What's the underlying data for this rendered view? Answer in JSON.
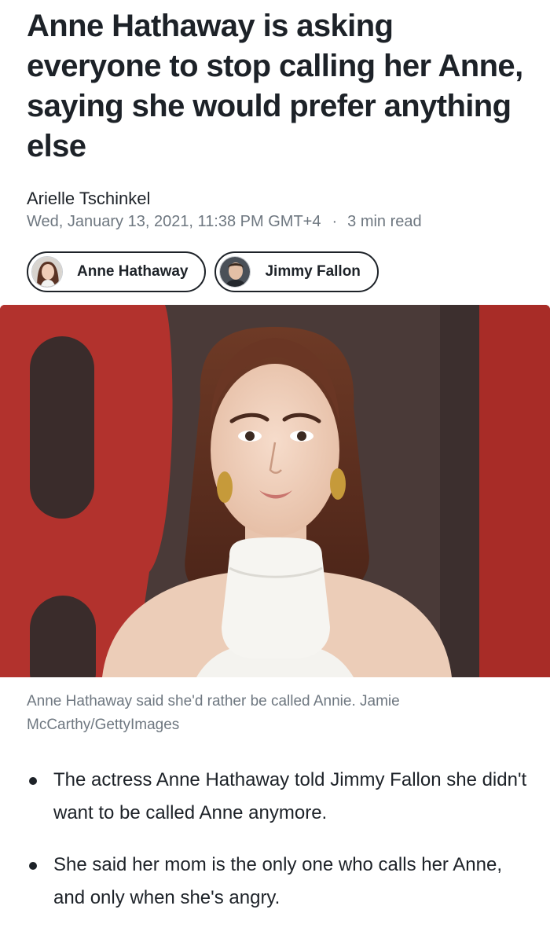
{
  "article": {
    "headline": "Anne Hathaway is asking everyone to stop calling her Anne, saying she would prefer anything else",
    "author": "Arielle Tschinkel",
    "date": "Wed, January 13, 2021, 11:38 PM GMT+4",
    "separator": "·",
    "read_time": "3 min read"
  },
  "tags": [
    {
      "label": "Anne Hathaway",
      "icon": "avatar-anne-hathaway"
    },
    {
      "label": "Jimmy Fallon",
      "icon": "avatar-jimmy-fallon"
    }
  ],
  "image": {
    "caption": "Anne Hathaway said she'd rather be called Annie. Jamie McCarthy/GettyImages"
  },
  "bullets": [
    "The actress Anne Hathaway told Jimmy Fallon she didn't want to be called Anne anymore.",
    "She said her mom is the only one who calls her Anne, and only when she's angry."
  ],
  "colors": {
    "text": "#1d2228",
    "muted": "#6e7780",
    "backdrop_red": "#b5302c"
  }
}
